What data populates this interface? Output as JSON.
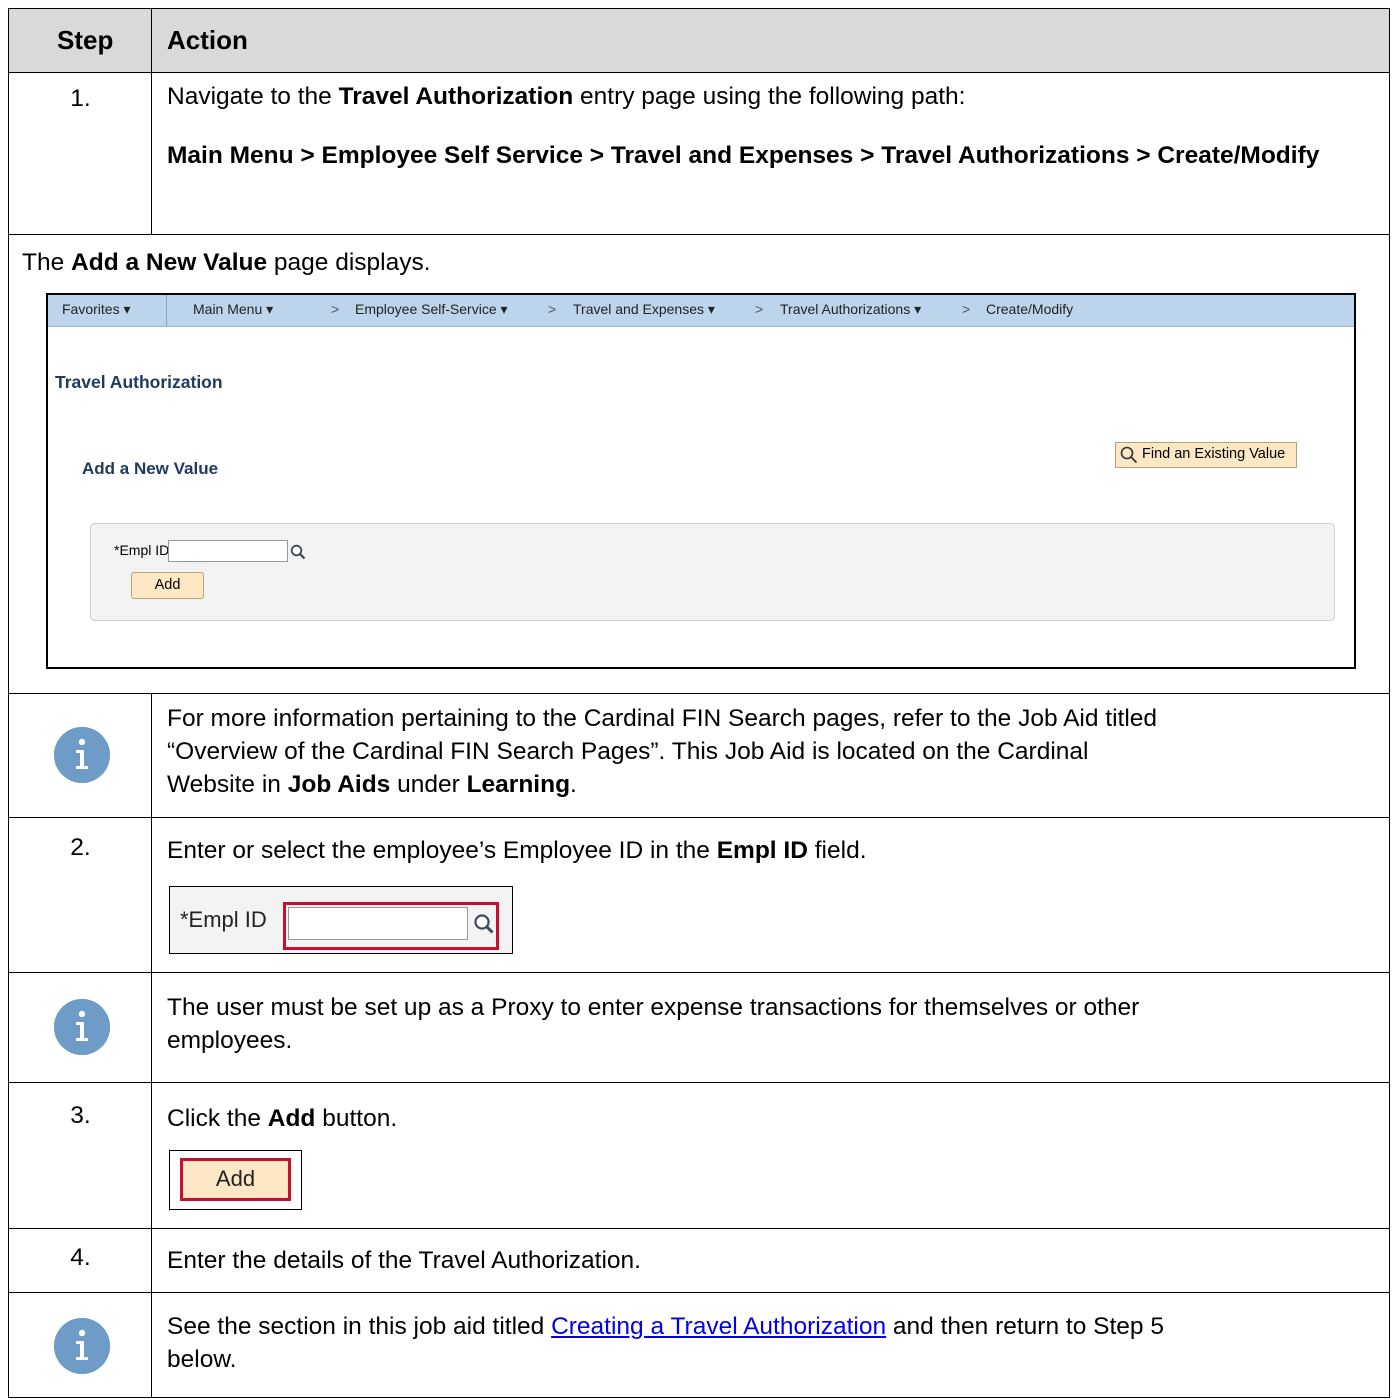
{
  "header": {
    "step": "Step",
    "action": "Action"
  },
  "step1": {
    "num": "1.",
    "text_pre": "Navigate to the ",
    "text_bold": "Travel Authorization",
    "text_post": " entry page using the following path:",
    "path": "Main Menu > Employee Self Service > Travel and Expenses > Travel Authorizations > Create/Modify"
  },
  "add_value_row": {
    "pre": "The ",
    "bold": "Add a New Value",
    "post": " page displays."
  },
  "screenshot": {
    "nav": {
      "favorites": "Favorites ▾",
      "main_menu": "Main Menu ▾",
      "sep1": ">",
      "ess": "Employee Self-Service ▾",
      "sep2": ">",
      "travel": "Travel and Expenses ▾",
      "sep3": ">",
      "ta": "Travel Authorizations ▾",
      "sep4": ">",
      "create": "Create/Modify"
    },
    "title": "Travel Authorization",
    "subtitle": "Add a New Value",
    "find_button": "Find an Existing Value",
    "empl_label": "*Empl ID",
    "empl_value": "",
    "add_button": "Add"
  },
  "info1": {
    "line1": "For more information pertaining to the Cardinal FIN Search pages, refer to the Job Aid titled",
    "line2": "“Overview of the Cardinal FIN Search Pages”.  This Job Aid is located on the Cardinal",
    "line3_pre": "Website in ",
    "line3_b1": "Job Aids",
    "line3_mid": " under ",
    "line3_b2": "Learning",
    "line3_post": "."
  },
  "step2": {
    "num": "2.",
    "pre": "Enter or select the employee’s Employee ID in the ",
    "bold": "Empl ID",
    "post": " field.",
    "crop_label": "*Empl ID"
  },
  "info2": {
    "line1": "The user must be set up as a Proxy to enter expense transactions for themselves or other",
    "line2": "employees."
  },
  "step3": {
    "num": "3.",
    "pre": "Click the ",
    "bold": "Add",
    "post": " button.",
    "button": "Add"
  },
  "step4": {
    "num": "4.",
    "text": "Enter the details of the Travel Authorization."
  },
  "info3": {
    "pre": "See the section in this job aid titled ",
    "link": "Creating a Travel Authorization",
    "post": " and then return to Step 5",
    "line2": "below."
  },
  "colors": {
    "header_bg": "#d9d9d9",
    "highlight": "#c8102e",
    "info_icon": "#6e9cc6",
    "nav_bg": "#bcd5ec",
    "button_bg": "#fde7c4"
  }
}
